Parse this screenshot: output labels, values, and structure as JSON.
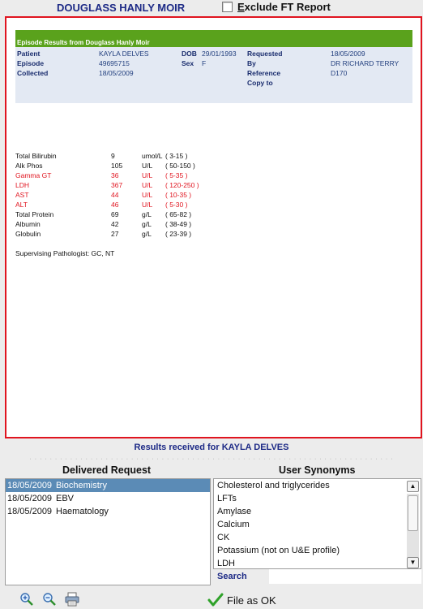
{
  "header": {
    "lab_name": "DOUGLASS HANLY MOIR",
    "exclude_label_first": "E",
    "exclude_label_rest": "xclude FT Report"
  },
  "report": {
    "episode_title": "Episode Results from Douglass Hanly Moir",
    "fields": {
      "patient_label": "Patient",
      "patient_value": "KAYLA DELVES",
      "episode_label": "Episode",
      "episode_value": "49695715",
      "collected_label": "Collected",
      "collected_value": "18/05/2009",
      "dob_label": "DOB",
      "dob_value": "29/01/1993",
      "sex_label": "Sex",
      "sex_value": "F",
      "requested_label": "Requested",
      "requested_value": "18/05/2009",
      "by_label": "By",
      "by_value": "DR RICHARD TERRY",
      "reference_label": "Reference",
      "reference_value": "D170",
      "copyto_label": "Copy to"
    },
    "results": [
      {
        "name": "Total Bilirubin",
        "value": "9",
        "unit": "umol/L",
        "range": "( 3-15 )",
        "abnormal": false
      },
      {
        "name": "Alk Phos",
        "value": "105",
        "unit": "U/L",
        "range": "( 50-150 )",
        "abnormal": false
      },
      {
        "name": "Gamma GT",
        "value": "36",
        "unit": "U/L",
        "range": "( 5-35 )",
        "abnormal": true
      },
      {
        "name": "LDH",
        "value": "367",
        "unit": "U/L",
        "range": "( 120-250 )",
        "abnormal": true
      },
      {
        "name": "AST",
        "value": "44",
        "unit": "U/L",
        "range": "( 10-35 )",
        "abnormal": true
      },
      {
        "name": "ALT",
        "value": "46",
        "unit": "U/L",
        "range": "( 5-30 )",
        "abnormal": true
      },
      {
        "name": "Total Protein",
        "value": "69",
        "unit": "g/L",
        "range": "( 65-82 )",
        "abnormal": false
      },
      {
        "name": "Albumin",
        "value": "42",
        "unit": "g/L",
        "range": "( 38-49 )",
        "abnormal": false
      },
      {
        "name": "Globulin",
        "value": "27",
        "unit": "g/L",
        "range": "( 23-39 )",
        "abnormal": false
      }
    ],
    "pathologist": "Supervising Pathologist: GC, NT"
  },
  "received_text": "Results received for KAYLA DELVES",
  "delivered": {
    "title": "Delivered Request",
    "items": [
      {
        "date": "18/05/2009",
        "name": "Biochemistry",
        "selected": true
      },
      {
        "date": "18/05/2009",
        "name": "EBV",
        "selected": false
      },
      {
        "date": "18/05/2009",
        "name": "Haematology",
        "selected": false
      }
    ]
  },
  "synonyms": {
    "title": "User Synonyms",
    "items": [
      "Cholesterol  and triglycerides",
      "LFTs",
      "Amylase",
      "Calcium",
      "CK",
      "Potassium (not on U&E profile)",
      "LDH"
    ],
    "search_label": "Search",
    "search_value": ""
  },
  "footer": {
    "file_ok_label": "File as OK"
  },
  "colors": {
    "accent_blue": "#1d2a86",
    "abnormal_red": "#e0141f",
    "header_green": "#5aa21c",
    "selection_blue": "#5b8bb6"
  },
  "icons": [
    "zoom-in-icon",
    "zoom-out-icon",
    "print-icon",
    "checkmark-icon"
  ]
}
